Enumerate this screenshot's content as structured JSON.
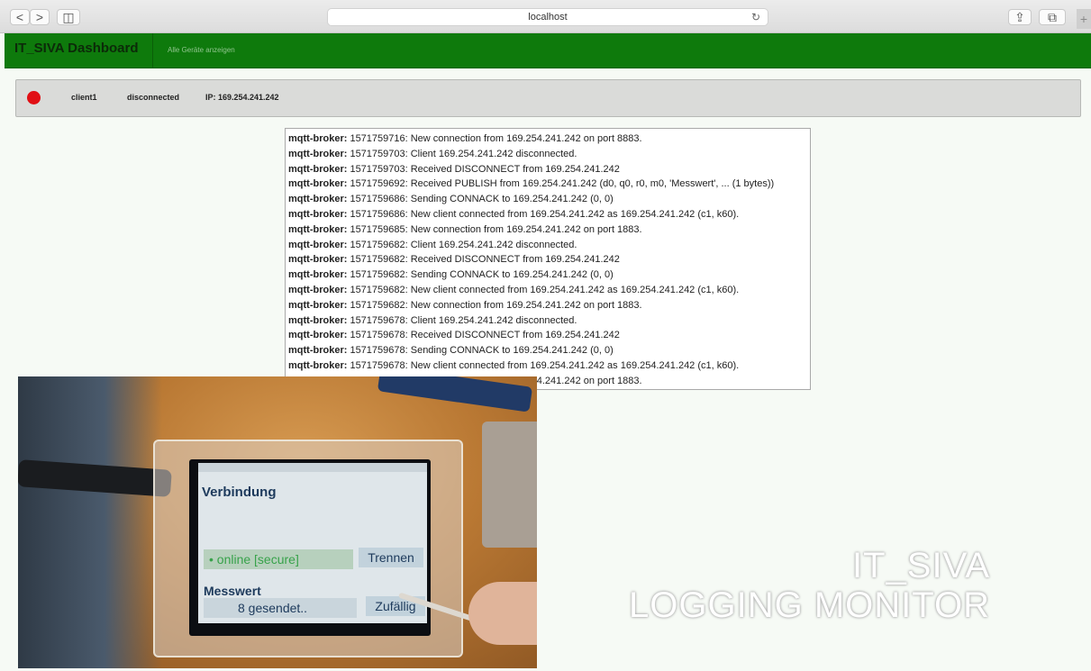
{
  "browser": {
    "back": "<",
    "forward": ">",
    "sidebar": "◫",
    "address": "localhost",
    "reload": "↻",
    "share": "⇪",
    "tabs": "⧉",
    "new_tab": "+"
  },
  "header": {
    "brand": "IT_SIVA Dashboard",
    "nav_link": "Alle Geräte anzeigen"
  },
  "colors": {
    "header_bg": "#0e7a0c",
    "status_disconnected": "#e10f14"
  },
  "device": {
    "name": "client1",
    "status": "disconnected",
    "ip": "IP: 169.254.241.242"
  },
  "log": {
    "source": "mqtt-broker:",
    "lines": [
      " 1571759716: New connection from 169.254.241.242 on port 8883.",
      " 1571759703: Client 169.254.241.242 disconnected.",
      " 1571759703: Received DISCONNECT from 169.254.241.242",
      " 1571759692: Received PUBLISH from 169.254.241.242 (d0, q0, r0, m0, 'Messwert', ... (1 bytes))",
      " 1571759686: Sending CONNACK to 169.254.241.242 (0, 0)",
      " 1571759686: New client connected from 169.254.241.242 as 169.254.241.242 (c1, k60).",
      " 1571759685: New connection from 169.254.241.242 on port 1883.",
      " 1571759682: Client 169.254.241.242 disconnected.",
      " 1571759682: Received DISCONNECT from 169.254.241.242",
      " 1571759682: Sending CONNACK to 169.254.241.242 (0, 0)",
      " 1571759682: New client connected from 169.254.241.242 as 169.254.241.242 (c1, k60).",
      " 1571759682: New connection from 169.254.241.242 on port 1883.",
      " 1571759678: Client 169.254.241.242 disconnected.",
      " 1571759678: Received DISCONNECT from 169.254.241.242",
      " 1571759678: Sending CONNACK to 169.254.241.242 (0, 0)",
      " 1571759678: New client connected from 169.254.241.242 as 169.254.241.242 (c1, k60).",
      " 1571759678: New connection from 169.254.241.242 on port 1883."
    ]
  },
  "device_screen": {
    "title": "Verbindung",
    "status": "• online [secure]",
    "disconnect_button": "Trennen",
    "value_title": "Messwert",
    "value_status": "8 gesendet..",
    "random_button": "Zufällig"
  },
  "watermark": {
    "line1": "IT_SIVA",
    "line2": "LOGGING MONITOR"
  }
}
